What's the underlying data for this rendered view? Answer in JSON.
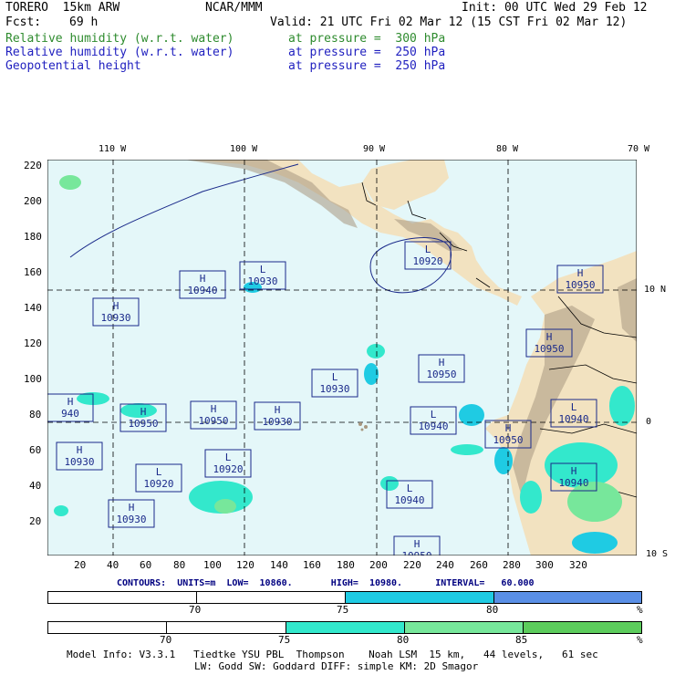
{
  "header": {
    "model": "TORERO  15km ARW",
    "org": "NCAR/MMM",
    "init": "Init: 00 UTC Wed 29 Feb 12",
    "fcst_label": "Fcst:",
    "fcst_value": "69 h",
    "valid": "Valid: 21 UTC Fri 02 Mar 12 (15 CST Fri 02 Mar 12)",
    "fields": [
      {
        "name": "Relative humidity (w.r.t. water)",
        "level": "at pressure =  300 hPa",
        "color": "#2e8b2e"
      },
      {
        "name": "Relative humidity (w.r.t. water)",
        "level": "at pressure =  250 hPa",
        "color": "#1f1fbf"
      },
      {
        "name": "Geopotential height",
        "level": "at pressure =  250 hPa",
        "color": "#1f1fbf"
      }
    ]
  },
  "map": {
    "top_lon_labels": [
      "110 W",
      "100 W",
      "90 W",
      "80 W",
      "70 W"
    ],
    "y_ticks": [
      "220",
      "200",
      "180",
      "160",
      "140",
      "120",
      "100",
      "80",
      "60",
      "40",
      "20"
    ],
    "x_ticks": [
      "20",
      "40",
      "60",
      "80",
      "100",
      "120",
      "140",
      "160",
      "180",
      "200",
      "220",
      "240",
      "260",
      "280",
      "300",
      "320"
    ],
    "right_lat_labels": [
      "10 N",
      "0",
      "10 S"
    ],
    "ocean_color": "#e4f7f9",
    "highs_lows": [
      {
        "type": "L",
        "value": "10920"
      },
      {
        "type": "H",
        "value": "10940"
      },
      {
        "type": "L",
        "value": "10930"
      },
      {
        "type": "H",
        "value": "10950"
      },
      {
        "type": "H",
        "value": "10950"
      },
      {
        "type": "H",
        "value": "10950"
      },
      {
        "type": "L",
        "value": "10930"
      },
      {
        "type": "H",
        "value": "10930"
      },
      {
        "type": "H",
        "value": "10950"
      },
      {
        "type": "H",
        "value": "10930"
      },
      {
        "type": "L",
        "value": "10940"
      },
      {
        "type": "H",
        "value": "10950"
      },
      {
        "type": "H",
        "value": "10950"
      },
      {
        "type": "H",
        "value": "10930"
      },
      {
        "type": "L",
        "value": "10920"
      },
      {
        "type": "L",
        "value": "10920"
      },
      {
        "type": "L",
        "value": "10940"
      },
      {
        "type": "H",
        "value": "10940"
      },
      {
        "type": "L",
        "value": "10940"
      },
      {
        "type": "H",
        "value": "10930"
      },
      {
        "type": "H",
        "value": "940"
      },
      {
        "type": "H",
        "value": "10950"
      }
    ]
  },
  "contours_text": "CONTOURS:  UNITS=m  LOW=  10860.       HIGH=  10980.      INTERVAL=   60.000",
  "colorbar_250": {
    "labels": [
      "70",
      "75",
      "80",
      "%"
    ],
    "colors": [
      "#ffffff",
      "#1fcbe3",
      "#5a8fe6"
    ]
  },
  "colorbar_300": {
    "labels": [
      "70",
      "75",
      "80",
      "85",
      "%"
    ],
    "colors": [
      "#ffffff",
      "#33e8cc",
      "#77e79b",
      "#5ccc5c"
    ]
  },
  "footer": {
    "line1": "Model Info: V3.3.1   Tiedtke YSU PBL  Thompson    Noah LSM  15 km,   44 levels,   61 sec",
    "line2": "LW: Godd SW: Goddard DIFF: simple KM: 2D Smagor"
  }
}
